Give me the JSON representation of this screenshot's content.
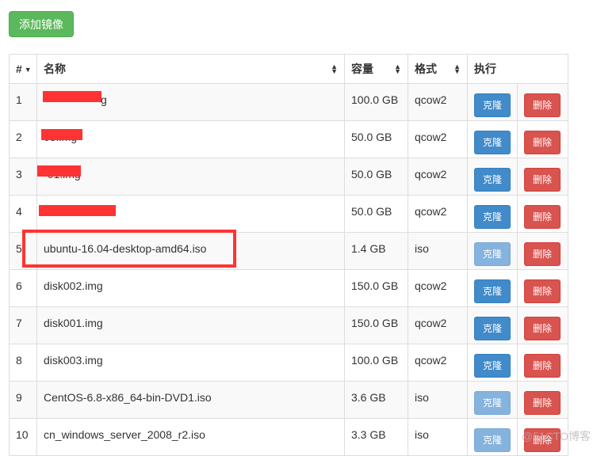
{
  "toolbar": {
    "add_image_label": "添加镜像"
  },
  "table": {
    "columns": {
      "index": "#",
      "name": "名称",
      "size": "容量",
      "format": "格式",
      "actions": "执行"
    },
    "rows": [
      {
        "index": "1",
        "name": "g",
        "size": "100.0 GB",
        "format": "qcow2",
        "clone_label": "克隆",
        "delete_label": "删除",
        "clone_disabled": false
      },
      {
        "index": "2",
        "name": "03.img",
        "size": "50.0 GB",
        "format": "qcow2",
        "clone_label": "克隆",
        "delete_label": "删除",
        "clone_disabled": false
      },
      {
        "index": "3",
        "name": "-01.img",
        "size": "50.0 GB",
        "format": "qcow2",
        "clone_label": "克隆",
        "delete_label": "删除",
        "clone_disabled": false
      },
      {
        "index": "4",
        "name": "",
        "size": "50.0 GB",
        "format": "qcow2",
        "clone_label": "克隆",
        "delete_label": "删除",
        "clone_disabled": false
      },
      {
        "index": "5",
        "name": "ubuntu-16.04-desktop-amd64.iso",
        "size": "1.4 GB",
        "format": "iso",
        "clone_label": "克隆",
        "delete_label": "删除",
        "clone_disabled": true
      },
      {
        "index": "6",
        "name": "disk002.img",
        "size": "150.0 GB",
        "format": "qcow2",
        "clone_label": "克隆",
        "delete_label": "删除",
        "clone_disabled": false
      },
      {
        "index": "7",
        "name": "disk001.img",
        "size": "150.0 GB",
        "format": "qcow2",
        "clone_label": "克隆",
        "delete_label": "删除",
        "clone_disabled": false
      },
      {
        "index": "8",
        "name": "disk003.img",
        "size": "100.0 GB",
        "format": "qcow2",
        "clone_label": "克隆",
        "delete_label": "删除",
        "clone_disabled": false
      },
      {
        "index": "9",
        "name": "CentOS-6.8-x86_64-bin-DVD1.iso",
        "size": "3.6 GB",
        "format": "iso",
        "clone_label": "克隆",
        "delete_label": "删除",
        "clone_disabled": true
      },
      {
        "index": "10",
        "name": "cn_windows_server_2008_r2.iso",
        "size": "3.3 GB",
        "format": "iso",
        "clone_label": "克隆",
        "delete_label": "删除",
        "clone_disabled": true
      }
    ]
  },
  "icons": {
    "sort_desc": "▼",
    "sort_both": "▲▼"
  },
  "colors": {
    "add_button": "#5cb85c",
    "clone_button": "#428bca",
    "clone_button_disabled": "#85b3dd",
    "delete_button": "#d9534f",
    "annotation_red": "#ff3333"
  },
  "watermark": "@51CTO博客"
}
